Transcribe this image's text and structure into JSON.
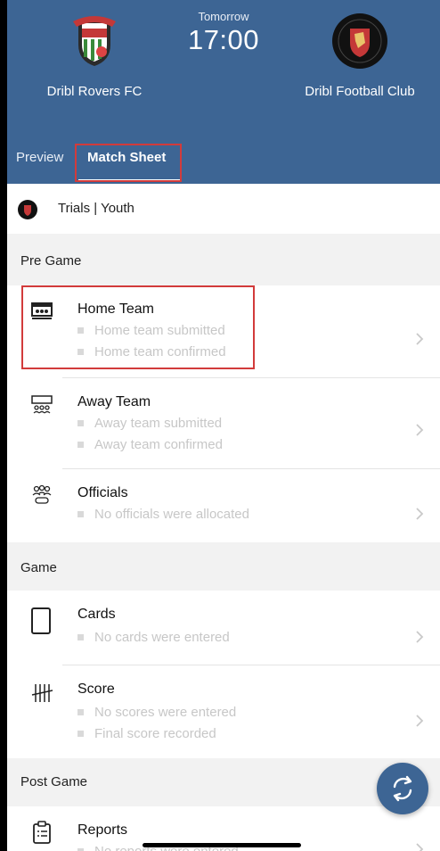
{
  "header": {
    "home_team": "Dribl Rovers FC",
    "away_team": "Dribl Football Club",
    "day": "Tomorrow",
    "time": "17:00",
    "tabs": [
      "Preview",
      "Match Sheet"
    ]
  },
  "competition": "Trials | Youth",
  "sections": {
    "pre_game": "Pre Game",
    "game": "Game",
    "post_game": "Post Game"
  },
  "rows": {
    "home_team": {
      "title": "Home Team",
      "lines": [
        "Home team submitted",
        "Home team confirmed"
      ]
    },
    "away_team": {
      "title": "Away Team",
      "lines": [
        "Away team submitted",
        "Away team confirmed"
      ]
    },
    "officials": {
      "title": "Officials",
      "lines": [
        "No officials were allocated"
      ]
    },
    "cards": {
      "title": "Cards",
      "lines": [
        "No cards were entered"
      ]
    },
    "score": {
      "title": "Score",
      "lines": [
        "No scores were entered",
        "Final score recorded"
      ]
    },
    "reports": {
      "title": "Reports",
      "lines": [
        "No reports were entered"
      ]
    }
  },
  "icons": {
    "home_team": "lineup-icon",
    "away_team": "lineup-outline-icon",
    "officials": "officials-icon",
    "cards": "card-icon",
    "score": "tally-icon",
    "reports": "clipboard-icon",
    "refresh": "refresh-icon"
  },
  "colors": {
    "header": "#3d6594",
    "highlight": "#d23b3b",
    "muted_text": "#c7c7c7"
  }
}
